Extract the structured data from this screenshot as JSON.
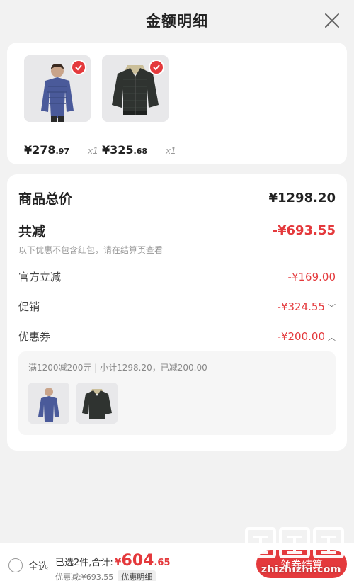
{
  "header": {
    "title": "金额明细"
  },
  "products": [
    {
      "price_int": "¥278",
      "price_dec": ".97",
      "qty": "x1",
      "checked": true
    },
    {
      "price_int": "¥325",
      "price_dec": ".68",
      "qty": "x1",
      "checked": true
    }
  ],
  "detail": {
    "total_label": "商品总价",
    "total_value": "¥1298.20",
    "reduce_label": "共减",
    "reduce_value": "-¥693.55",
    "hint": "以下优惠不包含红包，请在结算页查看",
    "official_label": "官方立减",
    "official_value": "-¥169.00",
    "promo_label": "促销",
    "promo_value": "-¥324.55",
    "coupon_label": "优惠券",
    "coupon_value": "-¥200.00",
    "coupon_desc": "满1200减200元 | 小计1298.20，已减200.00"
  },
  "bottom": {
    "select_all": "全选",
    "selected_prefix": "已选2件,合计:",
    "currency": "¥",
    "total_int": "604",
    "total_dec": ".65",
    "discount": "优惠减:¥693.55",
    "detail_tag": "优惠明细",
    "checkout": "领券结算"
  },
  "watermark": {
    "text": "zhizhizhi.com"
  },
  "colors": {
    "accent": "#e4393c",
    "jacket_blue": "#4a5a9a",
    "jacket_dark": "#2f3330"
  }
}
